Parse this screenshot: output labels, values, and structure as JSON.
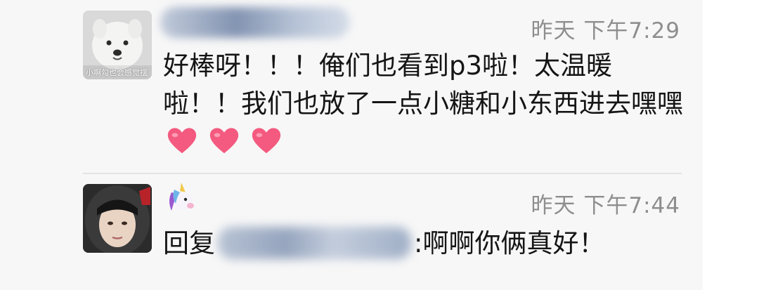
{
  "comments": [
    {
      "avatar_icon": "samoyed-avatar-icon",
      "avatar_watermark": "小啊勾也会感觉摆",
      "username_redacted": true,
      "time": "昨天 下午7:29",
      "text": "好棒呀！！！俺们也看到p3啦！太温暖啦！！我们也放了一点小糖和小东西进去嘿嘿",
      "emoji_hearts": [
        "heart-icon",
        "heart-icon",
        "heart-icon"
      ]
    },
    {
      "avatar_icon": "helmet-person-avatar-icon",
      "username_icon": "unicorn-icon",
      "time": "昨天 下午7:44",
      "reply_prefix": "回复",
      "reply_target_redacted": true,
      "reply_text": ":啊啊你俩真好！"
    }
  ],
  "colors": {
    "panel_bg": "#f7f7f7",
    "time_text": "#8e8e8e",
    "body_text": "#151515",
    "heart": "#f45a7f"
  }
}
